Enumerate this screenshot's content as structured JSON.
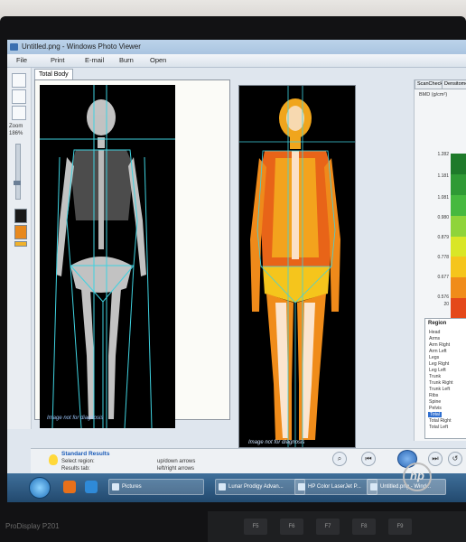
{
  "window": {
    "title": "Untitled.png - Windows Photo Viewer"
  },
  "menu": {
    "file": "File",
    "print": "Print",
    "email": "E-mail",
    "burn": "Burn",
    "open": "Open"
  },
  "sidebar": {
    "zoom_label": "Zoom",
    "zoom_value": "186%"
  },
  "tabs": {
    "main": "Total Body"
  },
  "scan": {
    "watermark_left": "Image not for diagnosis",
    "watermark_right": "Image not for diagnosis"
  },
  "right_tabs": {
    "scan_check": "ScanCheck",
    "densitometry": "Densitometr"
  },
  "bmd_scale": {
    "label": "BMD (g/cm²)",
    "ticks": [
      "1.282",
      "1.181",
      "1.081",
      "0.980",
      "0.879",
      "0.778",
      "0.677",
      "0.576",
      "20"
    ],
    "colors": [
      "#1e7a2a",
      "#2f9a35",
      "#46b93f",
      "#8fd43a",
      "#d9e627",
      "#f5c51c",
      "#f08c1a",
      "#e4481a",
      "#d61b1b"
    ]
  },
  "region_panel": {
    "header": "Region",
    "items": [
      "Head",
      "Arms",
      "Arm Right",
      "Arm Left",
      "Legs",
      "Leg Right",
      "Leg Left",
      "Trunk",
      "Trunk Right",
      "Trunk Left",
      "Ribs",
      "Spine",
      "Pelvis",
      "Total",
      "Total Right",
      "Total Left"
    ],
    "selected": "Total"
  },
  "status": {
    "title": "Standard Results",
    "line1": "Select region:",
    "line2": "Results tab:",
    "hint1": "up/down arrows",
    "hint2": "left/right arrows"
  },
  "taskbar": {
    "items": [
      "Pictures",
      "Lunar Prodigy Advan...",
      "HP Color LaserJet P...",
      "Untitled.png - Wind..."
    ]
  },
  "monitor": {
    "brand": "ProDisplay P201",
    "logo": "hp"
  },
  "keyboard": {
    "keys": [
      "F5",
      "F6",
      "F7",
      "F8",
      "F9"
    ]
  }
}
